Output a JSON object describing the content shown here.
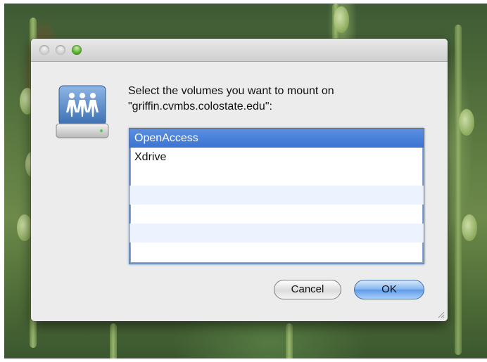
{
  "window": {
    "message_line1": "Select the volumes you want to mount on",
    "message_line2": "\"griffin.cvmbs.colostate.edu\":",
    "volumes": [
      {
        "label": "OpenAccess",
        "selected": true
      },
      {
        "label": "Xdrive",
        "selected": false
      }
    ],
    "buttons": {
      "cancel": "Cancel",
      "ok": "OK"
    },
    "icons": {
      "drive": "network-drive-icon",
      "close": "close-button",
      "minimize": "minimize-button",
      "zoom": "zoom-button"
    },
    "colors": {
      "selection": "#3c73d2",
      "ok_button": "#5f9ae6",
      "alt_row": "#edf3fe"
    }
  }
}
